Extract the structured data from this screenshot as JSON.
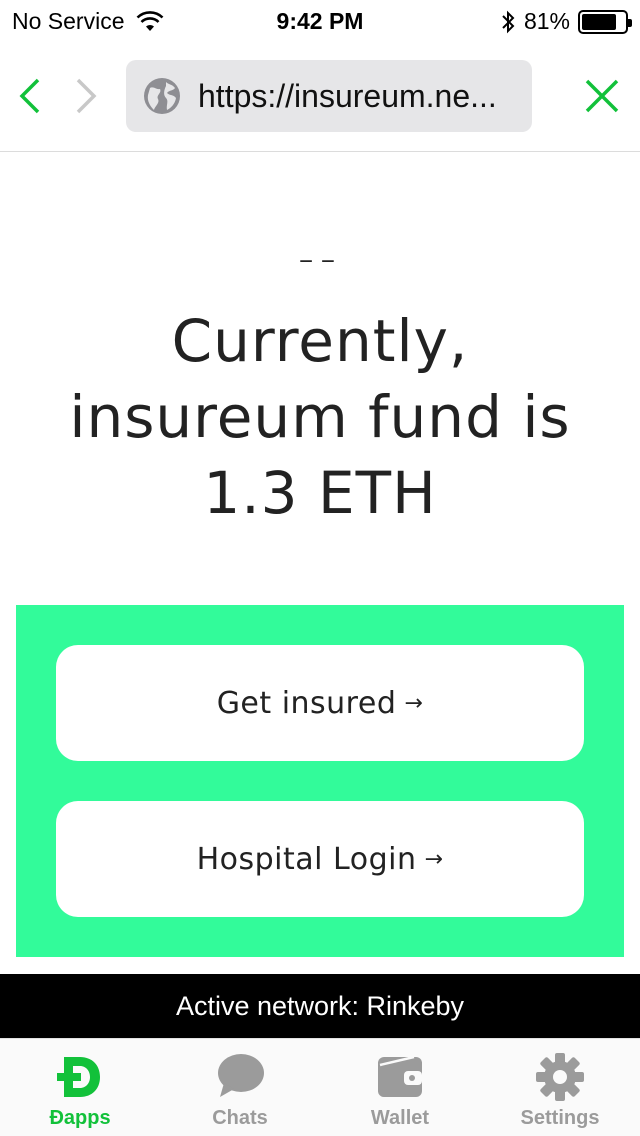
{
  "status_bar": {
    "carrier": "No Service",
    "time": "9:42 PM",
    "battery_percent": "81%",
    "battery_level": 0.81,
    "icons": [
      "wifi-icon",
      "bluetooth-icon",
      "battery-icon"
    ]
  },
  "browser": {
    "url": "https://insureum.ne...",
    "back_icon": "chevron-left-icon",
    "forward_icon": "chevron-right-icon",
    "close_icon": "close-icon",
    "globe_icon": "globe-icon",
    "accent_color": "#12c13a"
  },
  "content": {
    "dashes": "--",
    "fund_line1": "Currently,",
    "fund_line2": "insureum fund is",
    "fund_line3": "1.3 ETH",
    "panel_color": "#32fb9a",
    "buttons": {
      "get_insured": "Get insured",
      "hospital_login": "Hospital Login",
      "arrow": "→"
    }
  },
  "network_banner": {
    "text": "Active network: Rinkeby"
  },
  "tab_bar": {
    "tabs": [
      {
        "label": "Đapps",
        "icon": "dapps-icon",
        "active": true
      },
      {
        "label": "Chats",
        "icon": "chat-bubble-icon",
        "active": false
      },
      {
        "label": "Wallet",
        "icon": "wallet-icon",
        "active": false
      },
      {
        "label": "Settings",
        "icon": "gear-icon",
        "active": false
      }
    ]
  }
}
